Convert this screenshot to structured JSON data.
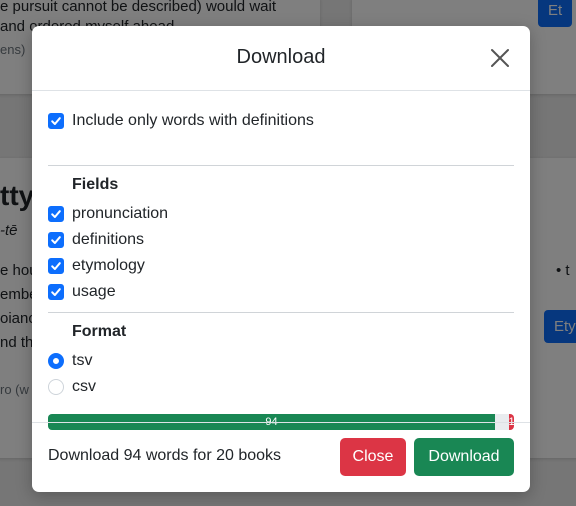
{
  "background": {
    "text_1": "e pursuit cannot be described) would wait",
    "text_2": "and ordered myself ahead",
    "text_3": "ens)",
    "heading": "tty",
    "pron": "-tē",
    "line_a": "e hou",
    "line_b": "embe",
    "line_c": "oianc",
    "line_d": "nd th",
    "line_e": "ro (w",
    "btn_top": "Et",
    "btn_right": "Ety",
    "bullet": "• t"
  },
  "modal": {
    "title": "Download",
    "include_only_label": "Include only words with definitions",
    "include_only_checked": true,
    "fields_heading": "Fields",
    "fields": [
      {
        "label": "pronunciation",
        "checked": true
      },
      {
        "label": "definitions",
        "checked": true
      },
      {
        "label": "etymology",
        "checked": true
      },
      {
        "label": "usage",
        "checked": true
      }
    ],
    "format_heading": "Format",
    "formats": [
      {
        "label": "tsv",
        "selected": true
      },
      {
        "label": "csv",
        "selected": false
      }
    ],
    "progress": {
      "segments": [
        {
          "label": "94",
          "value": 94,
          "color": "#198754"
        },
        {
          "label": "",
          "value": 3,
          "color": "#e9ecef"
        },
        {
          "label": "1",
          "value": 1,
          "color": "#dc3545"
        }
      ],
      "total": 98
    },
    "summary": "Download 94 words for 20 books",
    "close_label": "Close",
    "download_label": "Download"
  }
}
